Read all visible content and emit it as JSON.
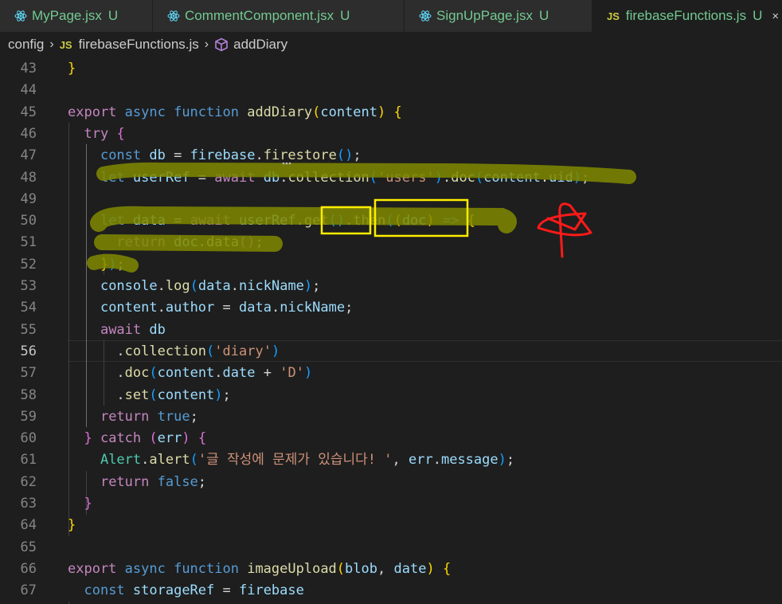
{
  "tabs": [
    {
      "name": "MyPage.jsx",
      "status": "U",
      "active": false
    },
    {
      "name": "CommentComponent.jsx",
      "status": "U",
      "active": false
    },
    {
      "name": "SignUpPage.jsx",
      "status": "U",
      "active": false
    },
    {
      "name": "firebaseFunctions.js",
      "status": "U",
      "active": true
    }
  ],
  "tab_icons": {
    "jsx": "react-icon",
    "js": "JS"
  },
  "breadcrumb": {
    "folder": "config",
    "file": "firebaseFunctions.js",
    "symbol": "addDiary",
    "file_icon": "JS"
  },
  "editor": {
    "current_line": 56,
    "lines": [
      {
        "n": "43",
        "t": [
          [
            "}",
            "br1"
          ]
        ]
      },
      {
        "n": "44",
        "t": []
      },
      {
        "n": "45",
        "t": [
          [
            "export ",
            "ctl"
          ],
          [
            "async ",
            "kw"
          ],
          [
            "function ",
            "kw"
          ],
          [
            "addDiary",
            "fn"
          ],
          [
            "(",
            "br1"
          ],
          [
            "content",
            "var"
          ],
          [
            ")",
            "br1"
          ],
          [
            " ",
            ""
          ],
          [
            "{",
            "br1"
          ]
        ]
      },
      {
        "n": "46",
        "t": [
          [
            "  ",
            ""
          ],
          [
            "try ",
            "ctl"
          ],
          [
            "{",
            "br2"
          ]
        ]
      },
      {
        "n": "47",
        "t": [
          [
            "    ",
            ""
          ],
          [
            "const ",
            "kw"
          ],
          [
            "db",
            "var"
          ],
          [
            " = ",
            ""
          ],
          [
            "firebase",
            "var"
          ],
          [
            ".",
            ""
          ],
          [
            "firestore",
            "fn"
          ],
          [
            "()",
            "br3"
          ],
          [
            ";",
            ""
          ]
        ]
      },
      {
        "n": "48",
        "t": [
          [
            "    ",
            ""
          ],
          [
            "let ",
            "kw"
          ],
          [
            "userRef",
            "var"
          ],
          [
            " = ",
            ""
          ],
          [
            "await ",
            "ctl"
          ],
          [
            "db",
            "var"
          ],
          [
            ".",
            ""
          ],
          [
            "collection",
            "fn"
          ],
          [
            "(",
            "br3"
          ],
          [
            "'users'",
            "str"
          ],
          [
            ")",
            "br3"
          ],
          [
            ".",
            ""
          ],
          [
            "doc",
            "fn"
          ],
          [
            "(",
            "br3"
          ],
          [
            "content",
            "var"
          ],
          [
            ".",
            ""
          ],
          [
            "uid",
            "var"
          ],
          [
            ")",
            "br3"
          ],
          [
            ";",
            ""
          ]
        ]
      },
      {
        "n": "49",
        "t": []
      },
      {
        "n": "50",
        "t": [
          [
            "    ",
            ""
          ],
          [
            "let ",
            "kw"
          ],
          [
            "data",
            "var"
          ],
          [
            " = ",
            ""
          ],
          [
            "await ",
            "ctl"
          ],
          [
            "userRef",
            "var"
          ],
          [
            ".",
            ""
          ],
          [
            "get",
            "fn"
          ],
          [
            "()",
            "br3"
          ],
          [
            ".",
            ""
          ],
          [
            "then",
            "fn"
          ],
          [
            "(",
            "br3"
          ],
          [
            "(",
            "br1"
          ],
          [
            "doc",
            "var"
          ],
          [
            ")",
            "br1"
          ],
          [
            " => ",
            "kw"
          ],
          [
            "{",
            "br1"
          ]
        ]
      },
      {
        "n": "51",
        "t": [
          [
            "      ",
            ""
          ],
          [
            "return ",
            "ctl"
          ],
          [
            "doc",
            "var"
          ],
          [
            ".",
            ""
          ],
          [
            "data",
            "fn"
          ],
          [
            "()",
            "br2"
          ],
          [
            ";",
            ""
          ]
        ]
      },
      {
        "n": "52",
        "t": [
          [
            "    ",
            ""
          ],
          [
            "}",
            "br1"
          ],
          [
            ")",
            "br3"
          ],
          [
            ";",
            ""
          ]
        ]
      },
      {
        "n": "53",
        "t": [
          [
            "    ",
            ""
          ],
          [
            "console",
            "var"
          ],
          [
            ".",
            ""
          ],
          [
            "log",
            "fn"
          ],
          [
            "(",
            "br3"
          ],
          [
            "data",
            "var"
          ],
          [
            ".",
            ""
          ],
          [
            "nickName",
            "var"
          ],
          [
            ")",
            "br3"
          ],
          [
            ";",
            ""
          ]
        ]
      },
      {
        "n": "54",
        "t": [
          [
            "    ",
            ""
          ],
          [
            "content",
            "var"
          ],
          [
            ".",
            ""
          ],
          [
            "author",
            "var"
          ],
          [
            " = ",
            ""
          ],
          [
            "data",
            "var"
          ],
          [
            ".",
            ""
          ],
          [
            "nickName",
            "var"
          ],
          [
            ";",
            ""
          ]
        ]
      },
      {
        "n": "55",
        "t": [
          [
            "    ",
            ""
          ],
          [
            "await ",
            "ctl"
          ],
          [
            "db",
            "var"
          ]
        ]
      },
      {
        "n": "56",
        "t": [
          [
            "      ",
            ""
          ],
          [
            ".",
            ""
          ],
          [
            "collection",
            "fn"
          ],
          [
            "(",
            "br3"
          ],
          [
            "'diary'",
            "str"
          ],
          [
            ")",
            "br3"
          ]
        ]
      },
      {
        "n": "57",
        "t": [
          [
            "      ",
            ""
          ],
          [
            ".",
            ""
          ],
          [
            "doc",
            "fn"
          ],
          [
            "(",
            "br3"
          ],
          [
            "content",
            "var"
          ],
          [
            ".",
            ""
          ],
          [
            "date",
            "var"
          ],
          [
            " + ",
            ""
          ],
          [
            "'D'",
            "str"
          ],
          [
            ")",
            "br3"
          ]
        ]
      },
      {
        "n": "58",
        "t": [
          [
            "      ",
            ""
          ],
          [
            ".",
            ""
          ],
          [
            "set",
            "fn"
          ],
          [
            "(",
            "br3"
          ],
          [
            "content",
            "var"
          ],
          [
            ")",
            "br3"
          ],
          [
            ";",
            ""
          ]
        ]
      },
      {
        "n": "59",
        "t": [
          [
            "    ",
            ""
          ],
          [
            "return ",
            "ctl"
          ],
          [
            "true",
            "kw"
          ],
          [
            ";",
            ""
          ]
        ]
      },
      {
        "n": "60",
        "t": [
          [
            "  ",
            ""
          ],
          [
            "} ",
            "br2"
          ],
          [
            "catch ",
            "ctl"
          ],
          [
            "(",
            "br2"
          ],
          [
            "err",
            "var"
          ],
          [
            ") ",
            "br2"
          ],
          [
            "{",
            "br2"
          ]
        ]
      },
      {
        "n": "61",
        "t": [
          [
            "    ",
            ""
          ],
          [
            "Alert",
            "cls"
          ],
          [
            ".",
            ""
          ],
          [
            "alert",
            "fn"
          ],
          [
            "(",
            "br3"
          ],
          [
            "'글 작성에 문제가 있습니다! '",
            "str"
          ],
          [
            ", ",
            ""
          ],
          [
            "err",
            "var"
          ],
          [
            ".",
            ""
          ],
          [
            "message",
            "var"
          ],
          [
            ")",
            "br3"
          ],
          [
            ";",
            ""
          ]
        ]
      },
      {
        "n": "62",
        "t": [
          [
            "    ",
            ""
          ],
          [
            "return ",
            "ctl"
          ],
          [
            "false",
            "kw"
          ],
          [
            ";",
            ""
          ]
        ]
      },
      {
        "n": "63",
        "t": [
          [
            "  ",
            ""
          ],
          [
            "}",
            "br2"
          ]
        ]
      },
      {
        "n": "64",
        "t": [
          [
            "}",
            "br1"
          ]
        ]
      },
      {
        "n": "65",
        "t": []
      },
      {
        "n": "66",
        "t": [
          [
            "export ",
            "ctl"
          ],
          [
            "async ",
            "kw"
          ],
          [
            "function ",
            "kw"
          ],
          [
            "imageUpload",
            "fn"
          ],
          [
            "(",
            "br1"
          ],
          [
            "blob",
            "var"
          ],
          [
            ", ",
            ""
          ],
          [
            "date",
            "var"
          ],
          [
            ")",
            "br1"
          ],
          [
            " ",
            ""
          ],
          [
            "{",
            "br1"
          ]
        ]
      },
      {
        "n": "67",
        "t": [
          [
            "  ",
            ""
          ],
          [
            "const ",
            "kw"
          ],
          [
            "storageRef",
            "var"
          ],
          [
            " = ",
            ""
          ],
          [
            "firebase",
            "var"
          ]
        ]
      }
    ]
  },
  "colors": {
    "highlighter": "#7f8a00",
    "box": "#ffee00",
    "pen": "#ff1a1a"
  }
}
